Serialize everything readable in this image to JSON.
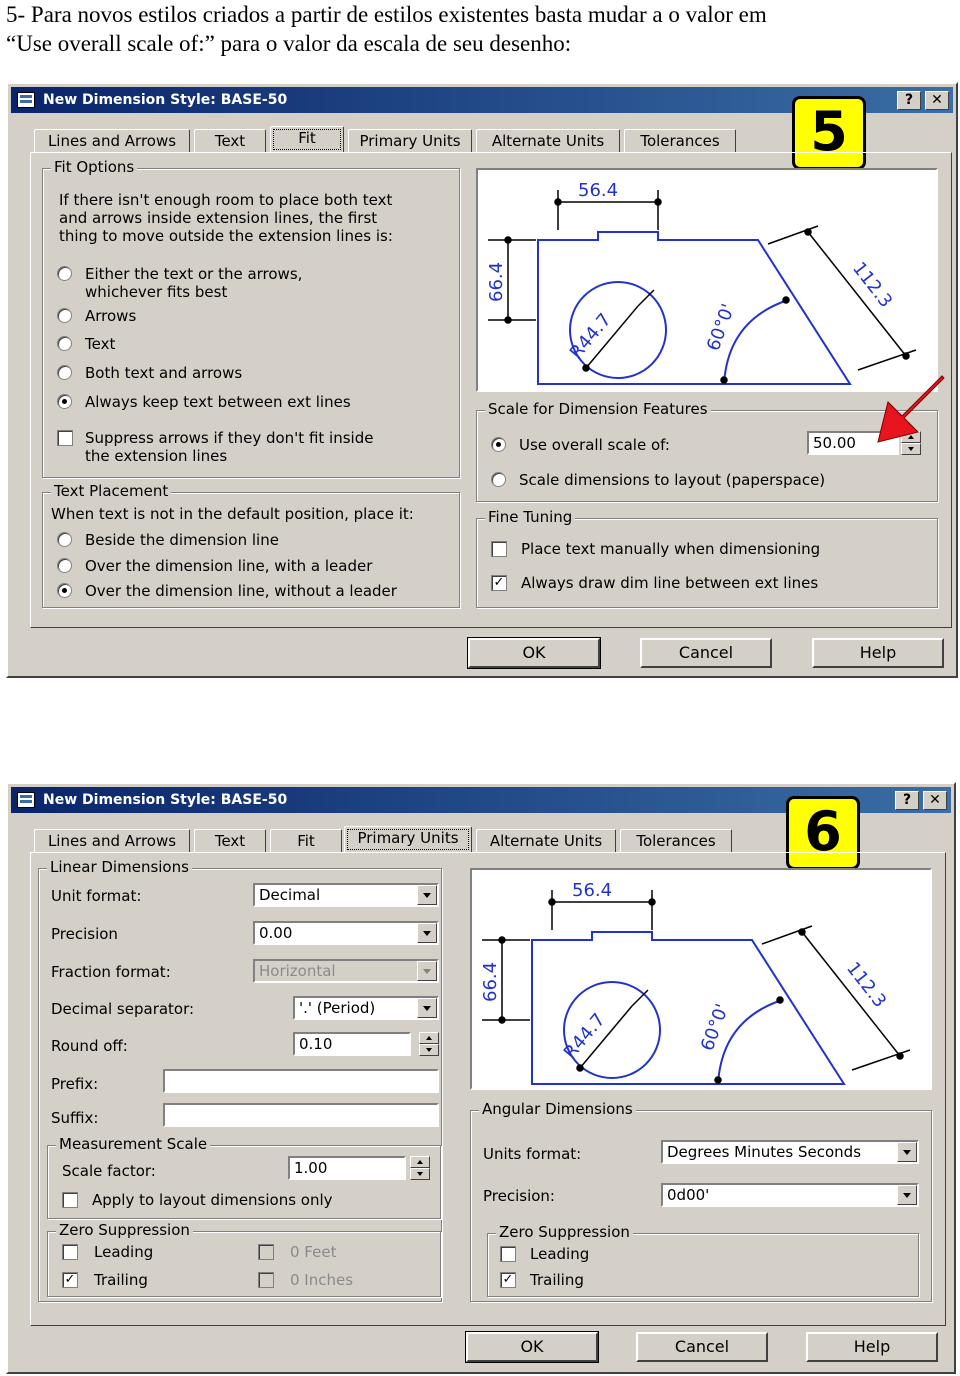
{
  "intro": {
    "line1": "5- Para novos estilos criados a partir de estilos existentes basta mudar a o valor em",
    "line2": "“Use overall scale of:” para o valor da escala de seu desenho:"
  },
  "title_buttons": {
    "help": "?",
    "close": "✕"
  },
  "preview": {
    "dim_horizontal": "56.4",
    "dim_vertical": "66.4",
    "dim_aligned": "112.3",
    "dim_radius": "R44.7",
    "dim_angle": "60°0'"
  },
  "dialog1": {
    "title": "New Dimension Style: BASE-50",
    "badge": "5",
    "tabs": [
      "Lines and Arrows",
      "Text",
      "Fit",
      "Primary Units",
      "Alternate Units",
      "Tolerances"
    ],
    "active_tab": "Fit",
    "fit_options": {
      "title": "Fit Options",
      "description": "If there isn't enough room to place both text\nand arrows inside extension lines, the first\nthing to move outside the extension lines is:",
      "radios": [
        {
          "label": "Either the text or the arrows,\nwhichever fits best",
          "selected": false
        },
        {
          "label": "Arrows",
          "selected": false
        },
        {
          "label": "Text",
          "selected": false
        },
        {
          "label": "Both text and arrows",
          "selected": false
        },
        {
          "label": "Always keep text between ext lines",
          "selected": true
        }
      ],
      "suppress_checkbox": {
        "label": "Suppress arrows if they don't fit inside\nthe extension lines",
        "checked": false
      }
    },
    "text_placement": {
      "title": "Text Placement",
      "description": "When text is not in the default position, place it:",
      "radios": [
        {
          "label": "Beside the dimension line",
          "selected": false
        },
        {
          "label": "Over the dimension line, with a leader",
          "selected": false
        },
        {
          "label": "Over the dimension line, without a leader",
          "selected": true
        }
      ]
    },
    "scale": {
      "title": "Scale for Dimension Features",
      "use_overall_label": "Use overall scale of:",
      "use_overall_value": "50.00",
      "use_overall_selected": true,
      "layout_label": "Scale dimensions to layout (paperspace)",
      "layout_selected": false
    },
    "fine_tuning": {
      "title": "Fine Tuning",
      "manual_label": "Place text manually when dimensioning",
      "manual_checked": false,
      "always_draw_label": "Always draw dim line between ext lines",
      "always_draw_checked": true
    },
    "buttons": {
      "ok": "OK",
      "cancel": "Cancel",
      "help": "Help"
    },
    "arrow_color": "#e8141e"
  },
  "dialog2": {
    "title": "New Dimension Style: BASE-50",
    "badge": "6",
    "tabs": [
      "Lines and Arrows",
      "Text",
      "Fit",
      "Primary Units",
      "Alternate Units",
      "Tolerances"
    ],
    "active_tab": "Primary Units",
    "linear": {
      "title": "Linear Dimensions",
      "unit_format_label": "Unit format:",
      "unit_format_value": "Decimal",
      "precision_label": "Precision",
      "precision_value": "0.00",
      "fraction_label": "Fraction format:",
      "fraction_value": "Horizontal",
      "decimal_sep_label": "Decimal separator:",
      "decimal_sep_value": "'.' (Period)",
      "round_off_label": "Round off:",
      "round_off_value": "0.10",
      "prefix_label": "Prefix:",
      "prefix_value": "",
      "suffix_label": "Suffix:",
      "suffix_value": ""
    },
    "measurement": {
      "title": "Measurement Scale",
      "scale_factor_label": "Scale factor:",
      "scale_factor_value": "1.00",
      "apply_label": "Apply to layout dimensions only",
      "apply_checked": false
    },
    "zero_linear": {
      "title": "Zero Suppression",
      "leading_label": "Leading",
      "leading_checked": false,
      "trailing_label": "Trailing",
      "trailing_checked": true,
      "feet_label": "0 Feet",
      "feet_checked": false,
      "inches_label": "0 Inches",
      "inches_checked": false
    },
    "angular": {
      "title": "Angular Dimensions",
      "units_label": "Units format:",
      "units_value": "Degrees Minutes Seconds",
      "precision_label": "Precision:",
      "precision_value": "0d00'"
    },
    "zero_angular": {
      "title": "Zero Suppression",
      "leading_label": "Leading",
      "leading_checked": false,
      "trailing_label": "Trailing",
      "trailing_checked": true
    },
    "buttons": {
      "ok": "OK",
      "cancel": "Cancel",
      "help": "Help"
    }
  }
}
